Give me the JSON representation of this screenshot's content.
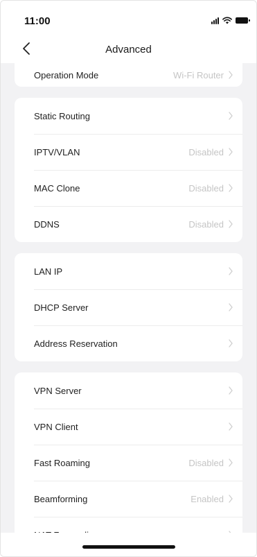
{
  "status_bar": {
    "time": "11:00"
  },
  "header": {
    "title": "Advanced"
  },
  "sections": [
    {
      "items": [
        {
          "label": "Operation Mode",
          "value": "Wi-Fi Router"
        }
      ]
    },
    {
      "items": [
        {
          "label": "Static Routing",
          "value": ""
        },
        {
          "label": "IPTV/VLAN",
          "value": "Disabled"
        },
        {
          "label": "MAC Clone",
          "value": "Disabled"
        },
        {
          "label": "DDNS",
          "value": "Disabled"
        }
      ]
    },
    {
      "items": [
        {
          "label": "LAN IP",
          "value": ""
        },
        {
          "label": "DHCP Server",
          "value": ""
        },
        {
          "label": "Address Reservation",
          "value": ""
        }
      ]
    },
    {
      "items": [
        {
          "label": "VPN Server",
          "value": ""
        },
        {
          "label": "VPN Client",
          "value": ""
        },
        {
          "label": "Fast Roaming",
          "value": "Disabled"
        },
        {
          "label": "Beamforming",
          "value": "Enabled"
        },
        {
          "label": "NAT Forwarding",
          "value": ""
        }
      ]
    }
  ]
}
